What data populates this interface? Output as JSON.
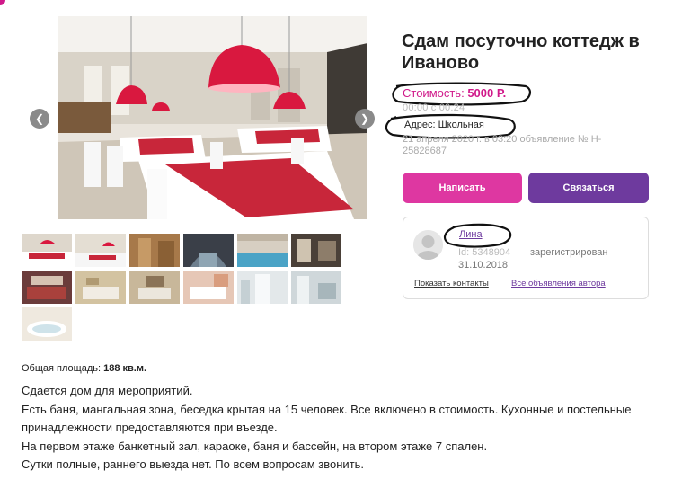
{
  "listing": {
    "title": "Сдам посуточно коттедж в Иваново",
    "price_label": "Стоимость:",
    "price_value": "5000 Р.",
    "hours_faded": "00:00 с 00:24",
    "address": "Адрес: Школьная",
    "published": "21 апреля 2020 г. в 03:20 объявление № H-25828687"
  },
  "gallery": {
    "prev_icon": "chevron-left-icon",
    "next_icon": "chevron-right-icon",
    "thumbnail_count": 13
  },
  "actions": {
    "write_label": "Написать",
    "contact_label": "Связаться"
  },
  "seller": {
    "name": "Лина",
    "id_faded": "Id: 5348904",
    "registered_label": "зарегистрирован",
    "registered_date": "31.10.2018",
    "show_contacts": "Показать контакты",
    "all_ads": "Все объявления автора"
  },
  "details": {
    "area_label": "Общая площадь:",
    "area_value": "188 кв.м.",
    "description": [
      "Сдается дом для мероприятий.",
      "Есть баня, мангальная зона, беседка крытая на 15 человек. Все включено в стоимость. Кухонные и постельные принадлежности предоставляются при въезде.",
      "На первом этаже банкетный зал, караоке, баня и бассейн, на втором этаже 7 спален.",
      "Сутки полные, раннего выезда нет. По всем вопросам звонить."
    ]
  },
  "colors": {
    "accent_pink": "#de37a1",
    "accent_purple": "#6e3a9e",
    "price_color": "#d0198a"
  }
}
